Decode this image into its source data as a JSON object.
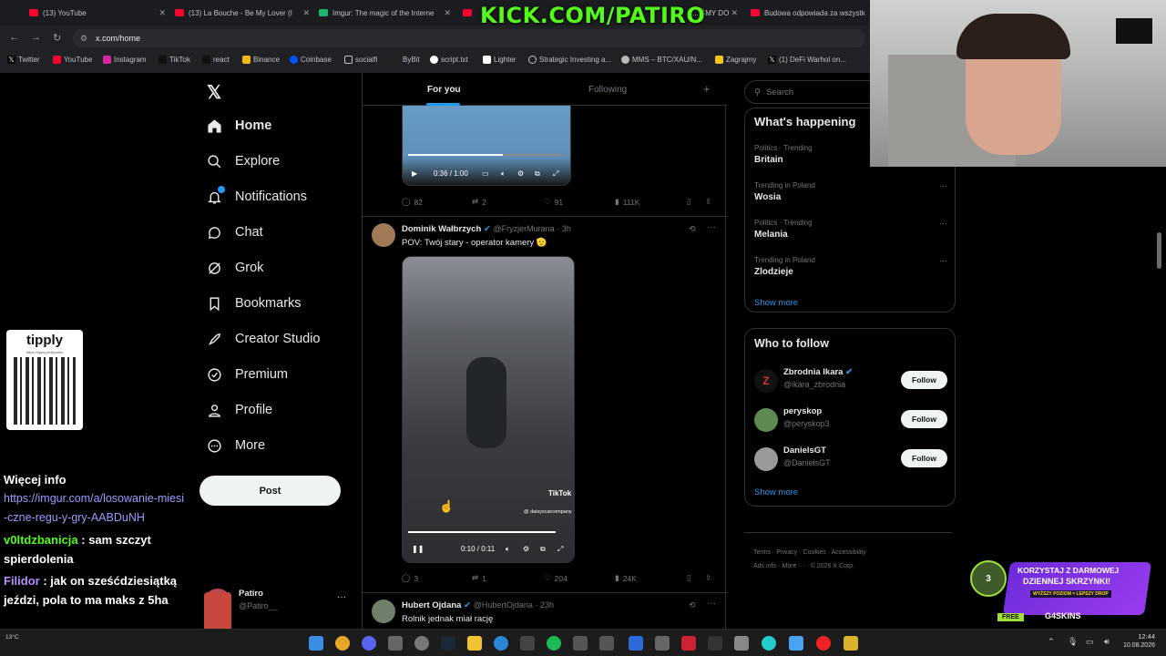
{
  "browser": {
    "tabs": [
      {
        "label": "(13) YouTube"
      },
      {
        "label": "(13) La Bouche - Be My Lover (I"
      },
      {
        "label": "Imgur: The magic of the Interne"
      },
      {
        "label": "Kick.com ...."
      },
      {
        "label": "... ŚMY DO"
      },
      {
        "label": "Budowa odpowiada za wszystk"
      }
    ],
    "url": "x.com/home",
    "bookmarks": [
      "Twitter",
      "YouTube",
      "Instagram",
      "TikTok",
      "react",
      "Binance",
      "Coinbase",
      "socialfi",
      "ByBit",
      "script.txt",
      "Lighter",
      "Strategic Investing a...",
      "MMS – BTC/XAU/N...",
      "Zagrajmy",
      "(1) DeFi Warhol on..."
    ]
  },
  "overlay": {
    "kick_banner": "KICK.COM/PATIRO",
    "tipply_label": "tipply",
    "tipply_url": "https://tipply.pl/@patiro",
    "chat": [
      {
        "user": "",
        "text": "Więcej info"
      },
      {
        "user": "",
        "link": "https://imgur.com/a/losowanie-miesi-czne-regu-y-gry-AABDuNH"
      },
      {
        "user": "v0ltdzbanicja",
        "text": ": sam szczyt spierdolenia"
      },
      {
        "user": "Filidor",
        "text": ": jak on sześćdziesiątką jeździ, pola to ma maks z 5ha"
      }
    ],
    "promo": {
      "line1": "KORZYSTAJ Z DARMOWEJ",
      "line2": "DZIENNEJ SKRZYNKI!",
      "line3": "WYŻSZY POZIOM = LEPSZY DROP",
      "free": "FREE",
      "brand": "G4SKINS",
      "level": "3"
    }
  },
  "nav": {
    "items": [
      "Home",
      "Explore",
      "Notifications",
      "Chat",
      "Grok",
      "Bookmarks",
      "Creator Studio",
      "Premium",
      "Profile",
      "More"
    ],
    "post_label": "Post",
    "profile_name": "Patiro",
    "profile_handle": "@Patiro__",
    "more_dots": "···"
  },
  "timeline": {
    "tab_for_you": "For you",
    "tab_following": "Following",
    "plus": "+",
    "tweets": [
      {
        "video_time": "0:36 / 1:00",
        "replies": "82",
        "reposts": "2",
        "likes": "91",
        "views": "111K"
      },
      {
        "name": "Dominik Wałbrzych",
        "handle": "@FryzjerMurana",
        "time": "· 3h",
        "text": "POV: Twój stary - operator kamery 🫡",
        "video_time": "0:10 / 0:11",
        "watermark": "TikTok",
        "watermark_user": "@ daisyscarcompany",
        "replies": "3",
        "reposts": "1",
        "likes": "204",
        "views": "24K"
      },
      {
        "name": "Hubert Ojdana",
        "handle": "@HubertOjdana",
        "time": "· 23h",
        "text": "Rolnik jednak miał rację"
      }
    ]
  },
  "right": {
    "search_placeholder": "Search",
    "whats_happening": "What's happening",
    "trends": [
      {
        "category": "Politics · Trending",
        "name": "Britain"
      },
      {
        "category": "Trending in Poland",
        "name": "Wosia"
      },
      {
        "category": "Politics · Trending",
        "name": "Melania"
      },
      {
        "category": "Trending in Poland",
        "name": "Zlodzieje"
      }
    ],
    "show_more": "Show more",
    "who_to_follow": "Who to follow",
    "follow_suggestions": [
      {
        "name": "Zbrodnia Ikara",
        "handle": "@ikara_zbrodnia",
        "button": "Follow"
      },
      {
        "name": "peryskop",
        "handle": "@peryskop3",
        "button": "Follow"
      },
      {
        "name": "DanielsGT",
        "handle": "@DanielsGT",
        "button": "Follow"
      }
    ],
    "show_more_2": "Show more",
    "footer": [
      "Terms",
      "Privacy",
      "Cookies",
      "Accessibility",
      "Ads info",
      "More ···",
      "© 2026 X Corp."
    ]
  },
  "taskbar": {
    "time": "12:44",
    "date": "10.08.2026",
    "weather": "13°C"
  },
  "colors": {
    "accent": "#1d9bf0",
    "kick_green": "#53fc18",
    "bg": "#000000"
  }
}
